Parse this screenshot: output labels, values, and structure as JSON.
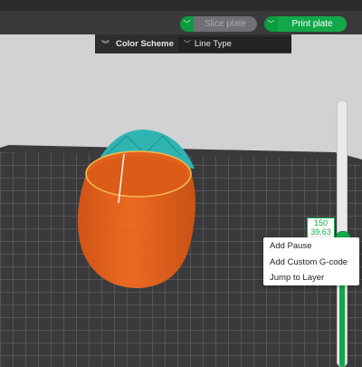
{
  "toolbar": {
    "slice_label": "Slice plate",
    "print_label": "Print plate",
    "dropdown_glyph": "﹀"
  },
  "color_scheme": {
    "title": "Color Scheme",
    "selected": "Line Type",
    "collapse_glyph": "︾",
    "caret_glyph": "﹀"
  },
  "layer_slider": {
    "top_value": "150",
    "height_value": "39.63",
    "fill_fraction": 0.49
  },
  "context_menu": {
    "items": [
      "Add Pause",
      "Add Custom G-code",
      "Jump to Layer"
    ]
  },
  "colors": {
    "accent": "#12a84a",
    "model_orange": "#e8661f",
    "support_teal": "#27b3b1",
    "plate": "#3b3b3d"
  }
}
